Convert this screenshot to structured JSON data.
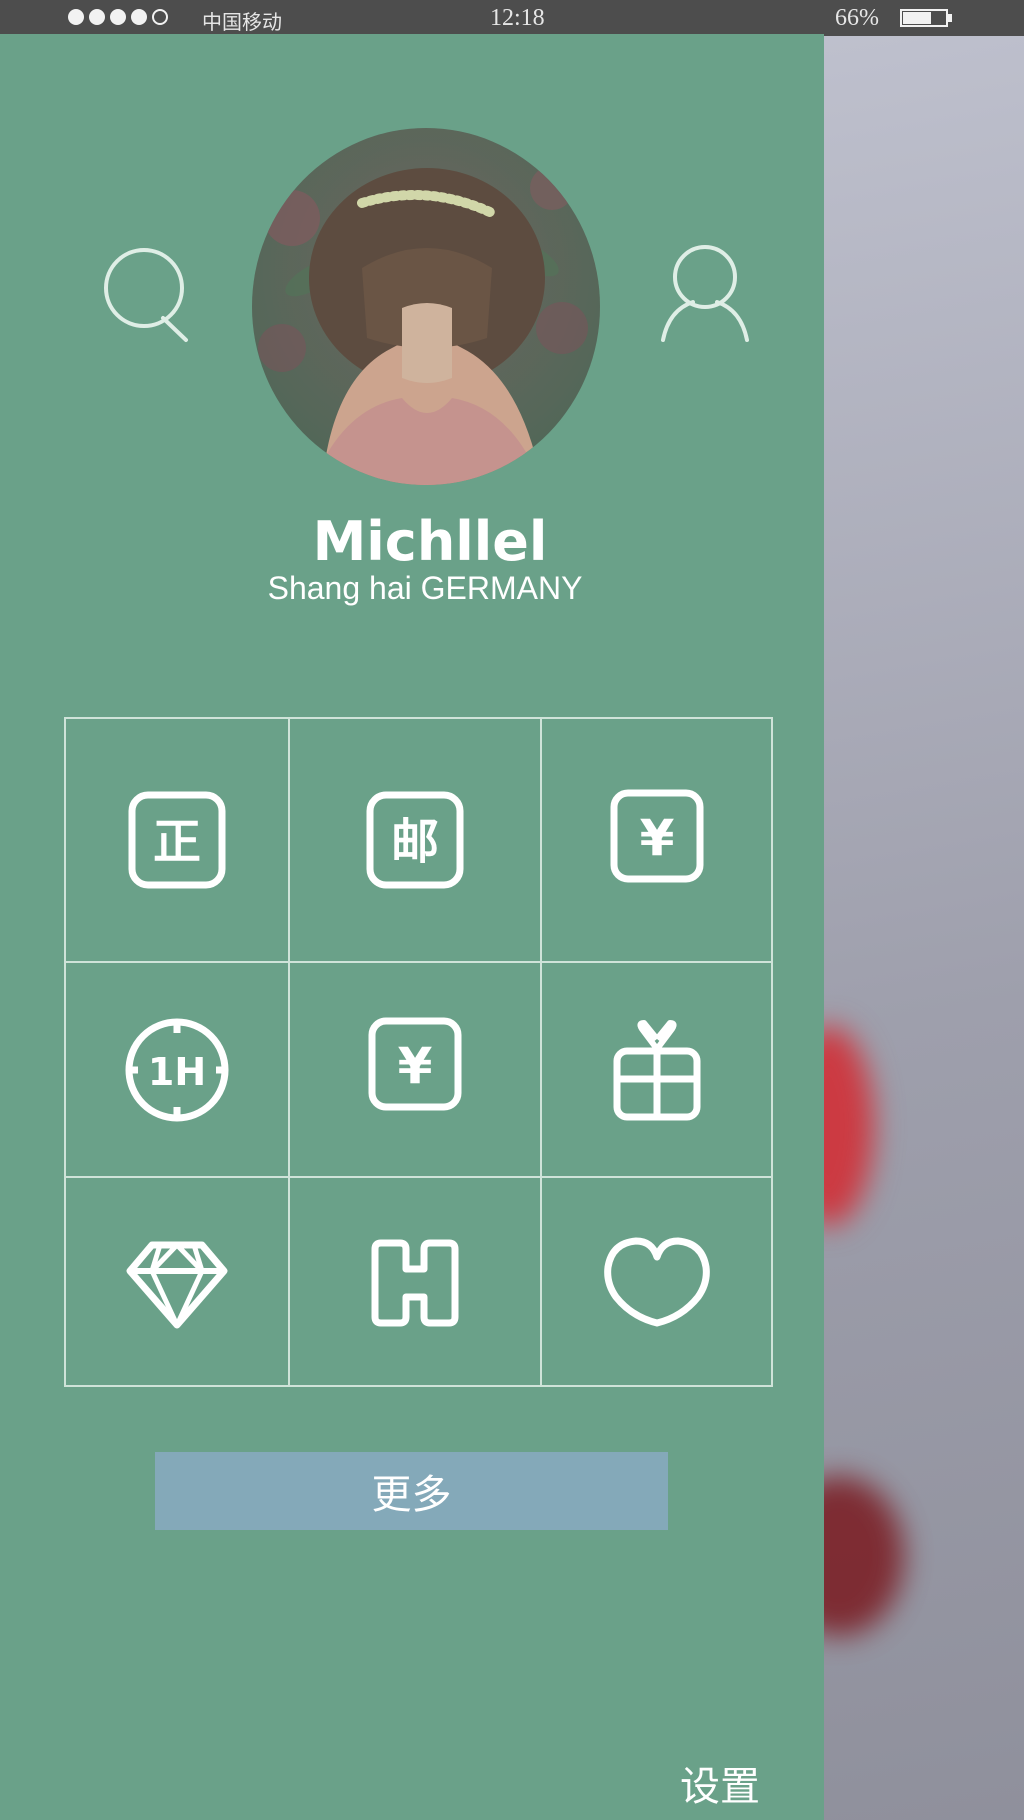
{
  "status_bar": {
    "carrier": "中国移动",
    "time": "12:18",
    "battery_percent": "66%",
    "battery_level": 0.66,
    "signal_bars_filled": 4,
    "signal_bars_total": 5
  },
  "profile": {
    "name": "Michllel",
    "location": "Shang hai GERMANY"
  },
  "toolbar": {
    "search_icon": "search-icon",
    "profile_icon": "user-icon"
  },
  "grid": {
    "items": [
      {
        "icon": "zheng-badge-icon",
        "glyph": "正"
      },
      {
        "icon": "mail-badge-icon",
        "glyph": "邮"
      },
      {
        "icon": "yen-badge-icon",
        "glyph": "¥"
      },
      {
        "icon": "one-hour-clock-icon",
        "glyph": "1H"
      },
      {
        "icon": "yen-badge-icon",
        "glyph": "¥"
      },
      {
        "icon": "gift-icon"
      },
      {
        "icon": "diamond-icon"
      },
      {
        "icon": "h-badge-icon"
      },
      {
        "icon": "heart-icon"
      }
    ]
  },
  "more_button": {
    "label": "更多"
  },
  "settings": {
    "label": "设置"
  },
  "colors": {
    "drawer_bg": "#6aa189",
    "more_button_bg": "#84a9b9",
    "status_bar_bg": "#4d4d4d",
    "grid_line": "#cfe3d9"
  }
}
